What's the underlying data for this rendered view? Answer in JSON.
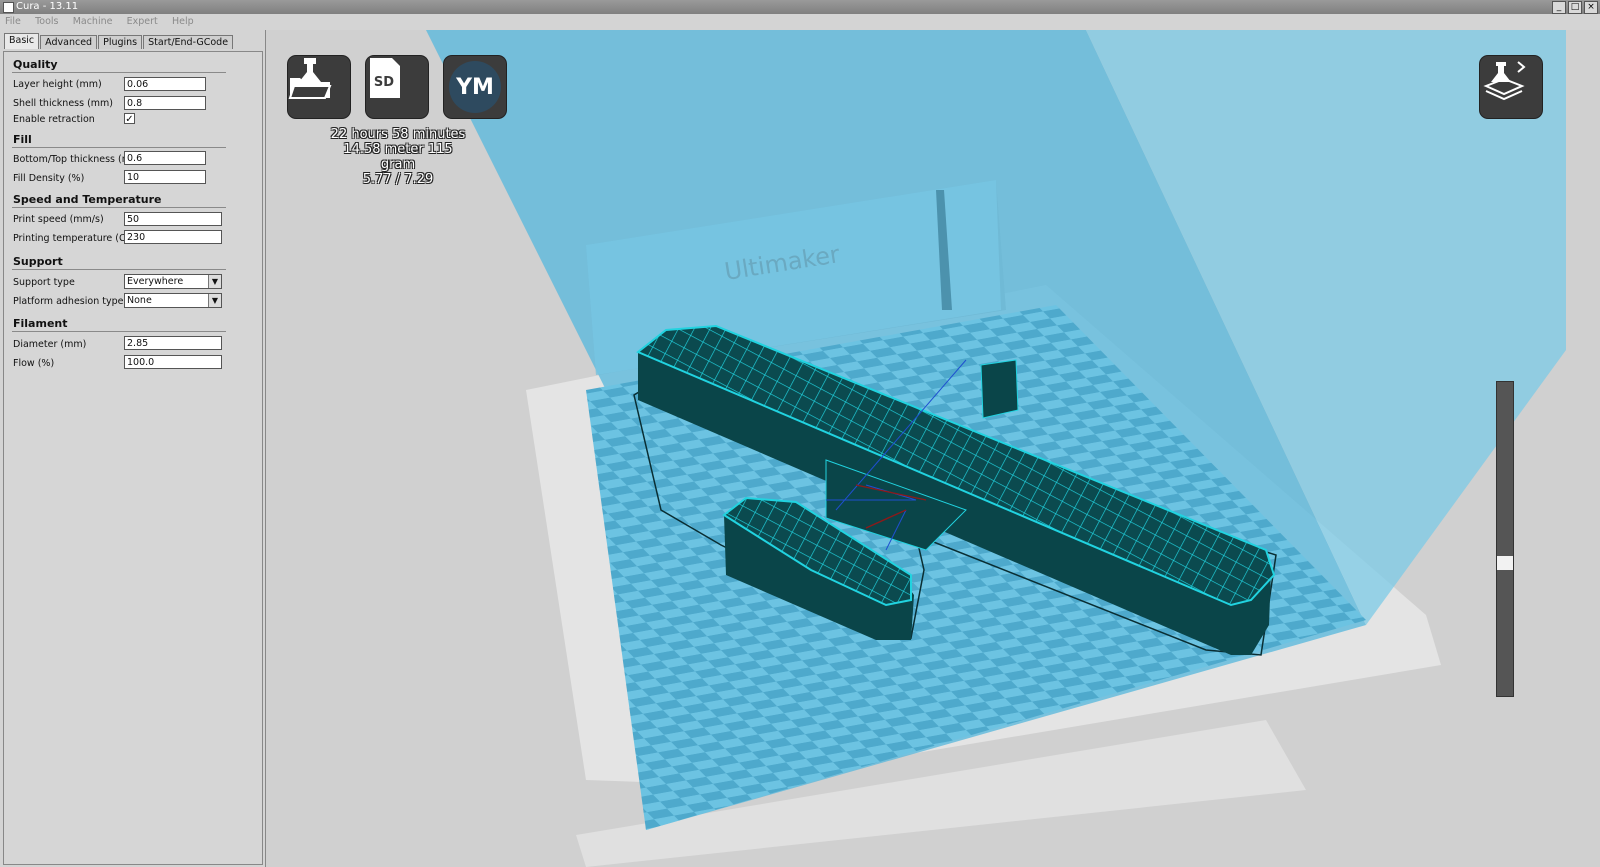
{
  "window": {
    "title": "Cura - 13.11",
    "controls": [
      "_",
      "□",
      "×"
    ]
  },
  "menu": [
    "File",
    "Tools",
    "Machine",
    "Expert",
    "Help"
  ],
  "tabs": [
    "Basic",
    "Advanced",
    "Plugins",
    "Start/End-GCode"
  ],
  "quality": {
    "title": "Quality",
    "layer_height_label": "Layer height (mm)",
    "layer_height": "0.06",
    "shell_thickness_label": "Shell thickness (mm)",
    "shell_thickness": "0.8",
    "retraction_label": "Enable retraction",
    "retraction_check": "✓"
  },
  "fill": {
    "title": "Fill",
    "bottom_top_label": "Bottom/Top thickness (mm)",
    "bottom_top": "0.6",
    "density_label": "Fill Density (%)",
    "density": "10"
  },
  "speed": {
    "title": "Speed and Temperature",
    "print_speed_label": "Print speed (mm/s)",
    "print_speed": "50",
    "temp_label": "Printing temperature (C)",
    "temp": "230"
  },
  "support": {
    "title": "Support",
    "type_label": "Support type",
    "type": "Everywhere",
    "adhesion_label": "Platform adhesion type",
    "adhesion": "None"
  },
  "filament": {
    "title": "Filament",
    "diameter_label": "Diameter (mm)",
    "diameter": "2.85",
    "flow_label": "Flow (%)",
    "flow": "100.0"
  },
  "toolbar": {
    "sd_label": "SD",
    "ym_label": "YM"
  },
  "print_info": {
    "time": "22 hours 58 minutes",
    "material": "14.58 meter 115 gram",
    "cost": "5.77 / 7.29"
  },
  "scene": {
    "brand_text": "Ultimaker"
  },
  "colors": {
    "build_volume": "#5ab8dc",
    "model": "#0b4a4f",
    "infill": "#21d3e0"
  }
}
